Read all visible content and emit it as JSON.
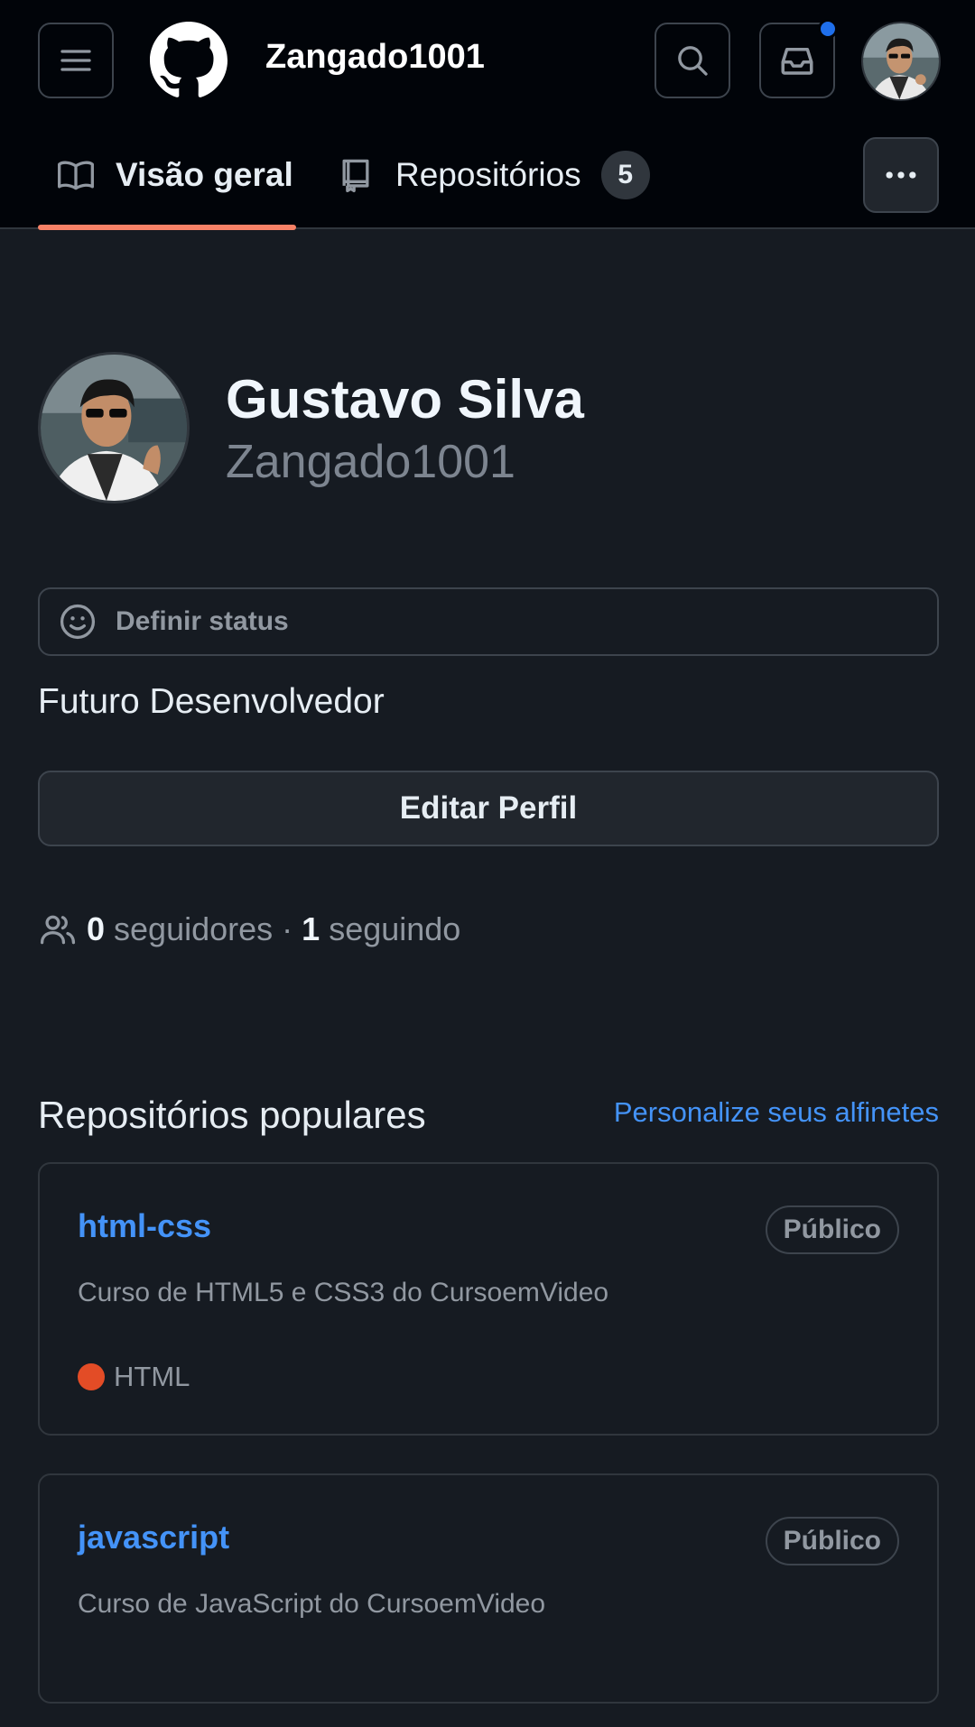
{
  "header": {
    "username": "Zangado1001",
    "notification_dot_color": "#1f6feb",
    "icons": {
      "menu": "hamburger-menu-icon",
      "logo": "github-logo-icon",
      "search": "search-icon",
      "inbox": "inbox-icon",
      "more": "kebab-menu-icon"
    }
  },
  "tabs": [
    {
      "label": "Visão geral",
      "icon": "book-icon",
      "selected": true
    },
    {
      "label": "Repositórios",
      "icon": "repo-icon",
      "count": "5",
      "selected": false
    }
  ],
  "profile": {
    "full_name": "Gustavo Silva",
    "login": "Zangado1001",
    "status_placeholder": "Definir status",
    "bio": "Futuro Desenvolvedor",
    "edit_button": "Editar Perfil",
    "followers_count": "0",
    "followers_label": "seguidores",
    "separator": "·",
    "following_count": "1",
    "following_label": "seguindo"
  },
  "popular": {
    "title": "Repositórios populares",
    "customize_link": "Personalize seus alfinetes",
    "repos": [
      {
        "name": "html-css",
        "visibility": "Público",
        "description": "Curso de HTML5 e CSS3 do CursoemVideo",
        "language": "HTML",
        "language_color": "#e34c26"
      },
      {
        "name": "javascript",
        "visibility": "Público",
        "description": "Curso de JavaScript do CursoemVideo"
      }
    ]
  },
  "colors": {
    "accent_link": "#4493f8",
    "tab_underline": "#f78166",
    "background": "#161b22",
    "header_background": "#010409"
  }
}
